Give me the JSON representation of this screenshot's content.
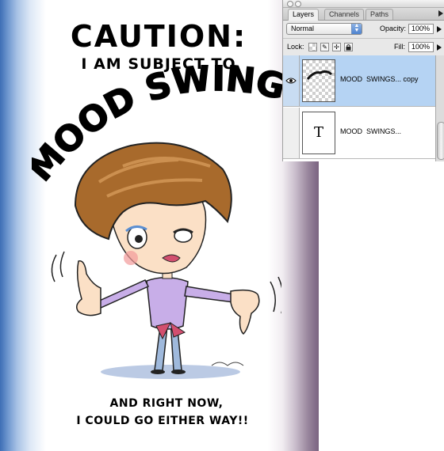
{
  "poster": {
    "title": "CAUTION:",
    "subtitle": "I AM SUBJECT TO",
    "headline": "MOOD SWINGS...",
    "bottom_line_1": "AND RIGHT NOW,",
    "bottom_line_2": "I COULD GO EITHER WAY!!"
  },
  "layers_panel": {
    "tabs": [
      {
        "label": "Layers",
        "active": true
      },
      {
        "label": "Channels",
        "active": false
      },
      {
        "label": "Paths",
        "active": false
      }
    ],
    "blend_mode": "Normal",
    "opacity_label": "Opacity:",
    "opacity_value": "100%",
    "lock_label": "Lock:",
    "fill_label": "Fill:",
    "fill_value": "100%",
    "layers": [
      {
        "name": "MOOD  SWINGS... copy",
        "type": "raster",
        "visible": true,
        "selected": true
      },
      {
        "name": "MOOD  SWINGS...",
        "type": "text",
        "visible": false,
        "selected": false,
        "thumb_glyph": "T"
      }
    ]
  },
  "icons": {
    "eye": "eye-icon",
    "lock_transparent": "lock-transparent-pixels-icon",
    "lock_image": "lock-image-pixels-icon",
    "lock_position": "lock-position-icon",
    "lock_all": "lock-all-icon",
    "type_layer": "type-layer-icon"
  },
  "colors": {
    "selected_row": "#b5d3f3",
    "poster_left_edge": "#3d6eb5",
    "poster_right_edge": "#7a6380"
  }
}
